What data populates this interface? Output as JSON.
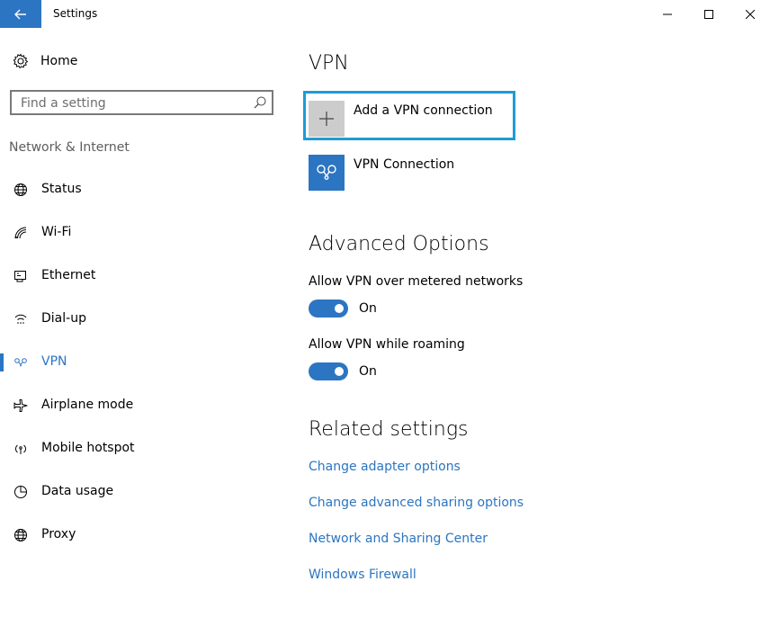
{
  "window": {
    "title": "Settings"
  },
  "sidebar": {
    "home_label": "Home",
    "search_placeholder": "Find a setting",
    "section_label": "Network & Internet",
    "items": [
      {
        "label": "Status",
        "icon": "globe-status-icon"
      },
      {
        "label": "Wi-Fi",
        "icon": "wifi-icon"
      },
      {
        "label": "Ethernet",
        "icon": "ethernet-icon"
      },
      {
        "label": "Dial-up",
        "icon": "dialup-icon"
      },
      {
        "label": "VPN",
        "icon": "vpn-icon",
        "active": true
      },
      {
        "label": "Airplane mode",
        "icon": "airplane-icon"
      },
      {
        "label": "Mobile hotspot",
        "icon": "hotspot-icon"
      },
      {
        "label": "Data usage",
        "icon": "data-usage-icon"
      },
      {
        "label": "Proxy",
        "icon": "globe-icon"
      }
    ]
  },
  "main": {
    "title": "VPN",
    "add_vpn_label": "Add a VPN connection",
    "vpn_connection_label": "VPN Connection",
    "advanced": {
      "title": "Advanced Options",
      "options": [
        {
          "label": "Allow VPN over metered networks",
          "state": "On"
        },
        {
          "label": "Allow VPN while roaming",
          "state": "On"
        }
      ]
    },
    "related": {
      "title": "Related settings",
      "links": [
        "Change adapter options",
        "Change advanced sharing options",
        "Network and Sharing Center",
        "Windows Firewall"
      ]
    }
  },
  "colors": {
    "accent": "#2b75c2",
    "focus_border": "#1e9bd7",
    "tile_gray": "#cccccc"
  }
}
